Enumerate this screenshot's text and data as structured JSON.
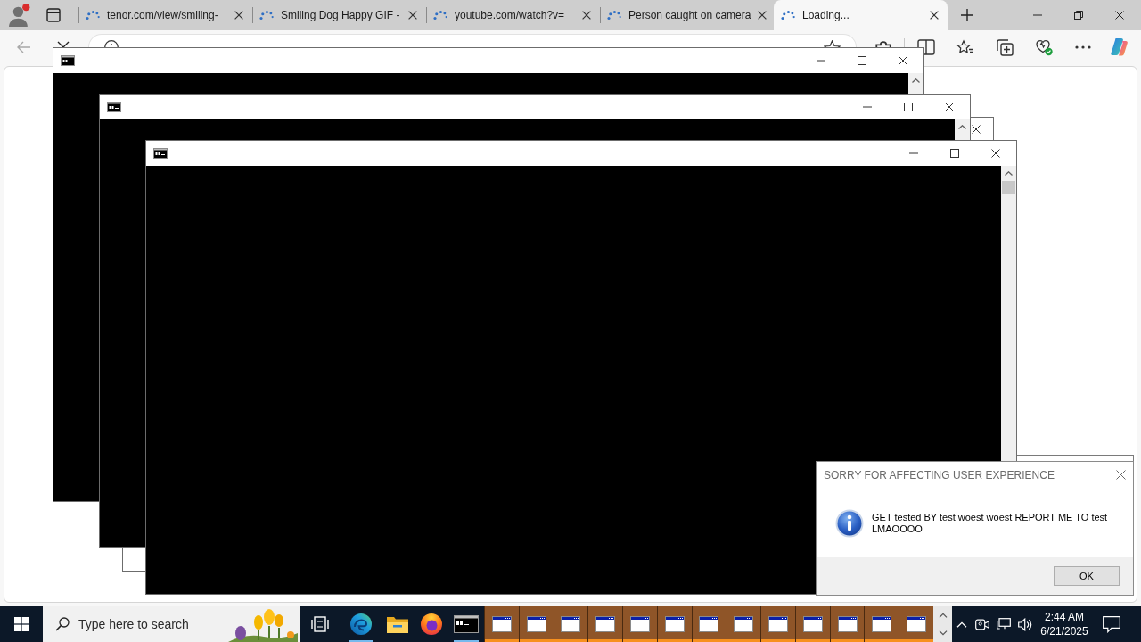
{
  "browser": {
    "tabs": [
      {
        "title": "tenor.com/view/smiling-",
        "selected": false
      },
      {
        "title": "Smiling Dog Happy GIF -",
        "selected": false
      },
      {
        "title": "youtube.com/watch?v=",
        "selected": false
      },
      {
        "title": "Person caught on camera",
        "selected": false
      },
      {
        "title": "Loading...",
        "selected": true
      }
    ]
  },
  "windows": [
    {
      "kind": "console"
    },
    {
      "kind": "console"
    },
    {
      "kind": "blank"
    },
    {
      "kind": "console"
    }
  ],
  "message_box": {
    "title": "SORRY FOR AFFECTING USER EXPERIENCE",
    "message": "GET tested BY test woest woest REPORT ME TO test LMAOOOO",
    "buttons": [
      "OK"
    ]
  },
  "taskbar": {
    "search": {
      "placeholder": "Type here to search"
    },
    "apps": [
      {
        "kind": "taskview",
        "running": false
      },
      {
        "kind": "edge",
        "running": true
      },
      {
        "kind": "explorer",
        "running": false
      },
      {
        "kind": "firefox",
        "running": false
      },
      {
        "kind": "terminal",
        "running": true
      }
    ],
    "window_buttons": [
      {
        "flashing": true
      },
      {
        "flashing": true
      },
      {
        "flashing": true
      },
      {
        "flashing": true
      },
      {
        "flashing": true
      },
      {
        "flashing": true
      },
      {
        "flashing": true
      },
      {
        "flashing": true
      },
      {
        "flashing": true
      },
      {
        "flashing": true
      },
      {
        "flashing": true
      },
      {
        "flashing": true
      },
      {
        "flashing": true
      }
    ],
    "clock": {
      "time": "2:44 AM",
      "date": "6/21/2025"
    }
  }
}
